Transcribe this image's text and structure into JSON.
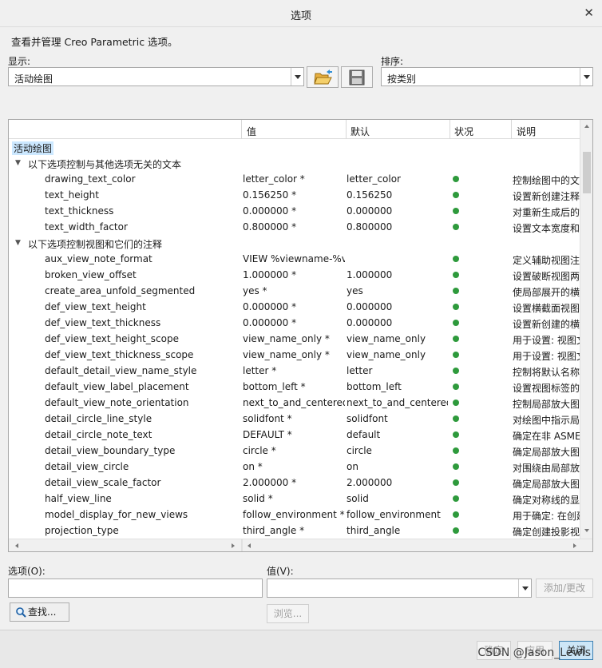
{
  "window": {
    "title": "选项"
  },
  "description": "查看并管理 Creo Parametric 选项。",
  "display": {
    "label": "显示:",
    "value": "活动绘图"
  },
  "sort": {
    "label": "排序:",
    "value": "按类别"
  },
  "table": {
    "columns": [
      "值",
      "默认",
      "状况",
      "说明"
    ],
    "root_label": "活动绘图",
    "groups": [
      {
        "title": "以下选项控制与其他选项无关的文本",
        "rows": [
          {
            "name": "drawing_text_color",
            "value": "letter_color *",
            "default": "letter_color",
            "desc": "控制绘图中的文"
          },
          {
            "name": "text_height",
            "value": "0.156250 *",
            "default": "0.156250",
            "desc": "设置新创建注释"
          },
          {
            "name": "text_thickness",
            "value": "0.000000 *",
            "default": "0.000000",
            "desc": "对重新生成后的"
          },
          {
            "name": "text_width_factor",
            "value": "0.800000 *",
            "default": "0.800000",
            "desc": "设置文本宽度和"
          }
        ]
      },
      {
        "title": "以下选项控制视图和它们的注释",
        "rows": [
          {
            "name": "aux_view_note_format",
            "value": "VIEW %viewname-%vi",
            "default": "",
            "desc": "定义辅助视图注"
          },
          {
            "name": "broken_view_offset",
            "value": "1.000000 *",
            "default": "1.000000",
            "desc": "设置破断视图两"
          },
          {
            "name": "create_area_unfold_segmented",
            "value": "yes *",
            "default": "yes",
            "desc": "使局部展开的横"
          },
          {
            "name": "def_view_text_height",
            "value": "0.000000 *",
            "default": "0.000000",
            "desc": "设置横截面视图"
          },
          {
            "name": "def_view_text_thickness",
            "value": "0.000000 *",
            "default": "0.000000",
            "desc": "设置新创建的横"
          },
          {
            "name": "def_view_text_height_scope",
            "value": "view_name_only *",
            "default": "view_name_only",
            "desc": "用于设置: 视图文"
          },
          {
            "name": "def_view_text_thickness_scope",
            "value": "view_name_only *",
            "default": "view_name_only",
            "desc": "用于设置: 视图文"
          },
          {
            "name": "default_detail_view_name_style",
            "value": "letter *",
            "default": "letter",
            "desc": "控制将默认名称"
          },
          {
            "name": "default_view_label_placement",
            "value": "bottom_left *",
            "default": "bottom_left",
            "desc": "设置视图标签的"
          },
          {
            "name": "default_view_note_orientation",
            "value": "next_to_and_centered",
            "default": "next_to_and_centered",
            "desc": "控制局部放大图"
          },
          {
            "name": "detail_circle_line_style",
            "value": "solidfont *",
            "default": "solidfont",
            "desc": "对绘图中指示局"
          },
          {
            "name": "detail_circle_note_text",
            "value": "DEFAULT *",
            "default": "default",
            "desc": "确定在非 ASME"
          },
          {
            "name": "detail_view_boundary_type",
            "value": "circle *",
            "default": "circle",
            "desc": "确定局部放大图"
          },
          {
            "name": "detail_view_circle",
            "value": "on *",
            "default": "on",
            "desc": "对围绕由局部放"
          },
          {
            "name": "detail_view_scale_factor",
            "value": "2.000000 *",
            "default": "2.000000",
            "desc": "确定局部放大图"
          },
          {
            "name": "half_view_line",
            "value": "solid *",
            "default": "solid",
            "desc": "确定对称线的显"
          },
          {
            "name": "model_display_for_new_views",
            "value": "follow_environment *",
            "default": "follow_environment",
            "desc": "用于确定: 在创建"
          },
          {
            "name": "projection_type",
            "value": "third_angle *",
            "default": "third_angle",
            "desc": "确定创建投影视"
          }
        ]
      }
    ]
  },
  "option_field": {
    "label": "选项(O):",
    "value": ""
  },
  "value_field": {
    "label": "值(V):",
    "value": ""
  },
  "buttons": {
    "find": "查找...",
    "add_change": "添加/更改",
    "browse": "浏览...",
    "ok": "确定",
    "apply": "应用",
    "close": "关闭"
  },
  "watermark": "CSDN @Jason_Lewis",
  "colors": {
    "status_ok": "#2e9a3c",
    "selection": "#cce8ff",
    "primary_button": "#cde6f7"
  }
}
